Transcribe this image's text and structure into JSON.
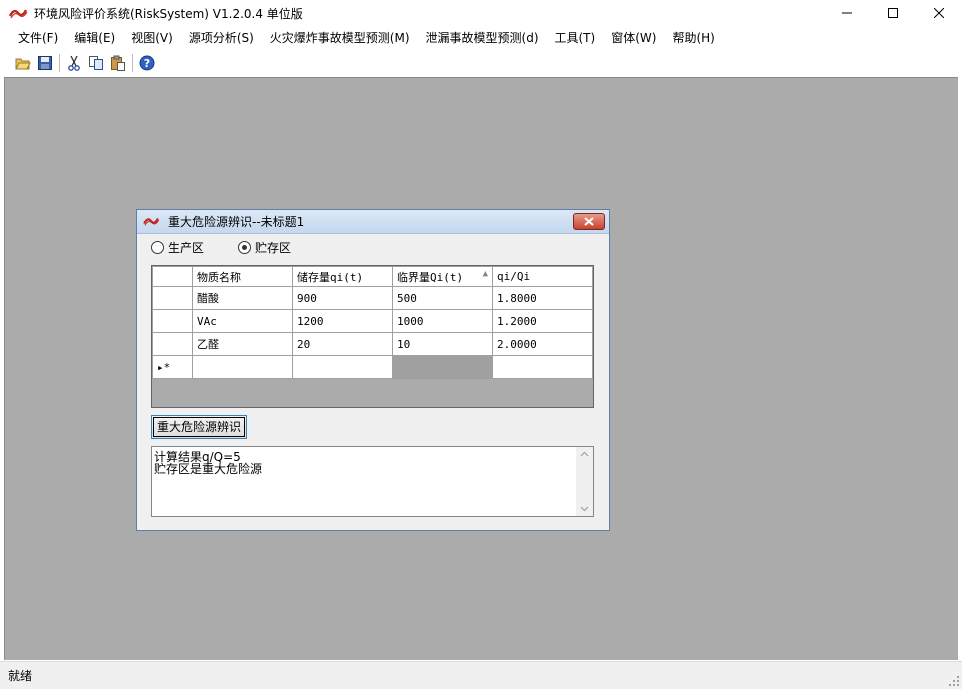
{
  "window": {
    "title": "环境风险评价系统(RiskSystem) V1.2.0.4 单位版",
    "logo_icon": "app-logo-icon",
    "controls": [
      "minimize-icon",
      "maximize-icon",
      "close-icon"
    ]
  },
  "menu": {
    "items": [
      "文件(F)",
      "编辑(E)",
      "视图(V)",
      "源项分析(S)",
      "火灾爆炸事故模型预测(M)",
      "泄漏事故模型预测(d)",
      "工具(T)",
      "窗体(W)",
      "帮助(H)"
    ]
  },
  "toolbar": {
    "icons": [
      "open-folder-icon",
      "save-icon",
      "cut-icon",
      "copy-icon",
      "paste-icon",
      "help-icon"
    ]
  },
  "dialog": {
    "title": "重大危险源辨识--未标题1",
    "radios": [
      {
        "label": "生产区",
        "checked": false
      },
      {
        "label": "贮存区",
        "checked": true
      }
    ],
    "grid": {
      "headers": [
        "物质名称",
        "储存量qi(t)",
        "临界量Qi(t)",
        "qi/Qi"
      ],
      "rows": [
        [
          "醋酸",
          "900",
          "500",
          "1.8000"
        ],
        [
          "VAc",
          "1200",
          "1000",
          "1.2000"
        ],
        [
          "乙醛",
          "20",
          "10",
          "2.0000"
        ]
      ],
      "new_row_marker": "▸*"
    },
    "identify_button": "重大危险源辨识",
    "result_lines": [
      "计算结果q/Q=5",
      "贮存区是重大危险源"
    ]
  },
  "status": {
    "text": "就绪"
  },
  "colors": {
    "mdi_background": "#ababab",
    "dialog_background": "#f0f0f0",
    "close_button": "#c7432e"
  }
}
